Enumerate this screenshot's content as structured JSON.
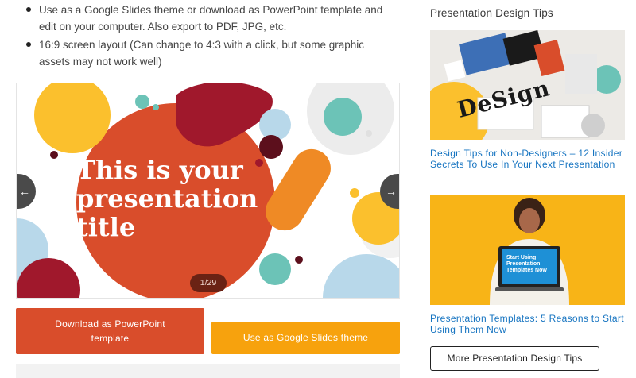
{
  "features": {
    "bullets": [
      "Use as a Google Slides theme or download as PowerPoint template and edit on your computer. Also export to PDF, JPG, etc.",
      "16:9 screen layout (Can change to 4:3 with a click, but some graphic assets may not work well)"
    ]
  },
  "slider": {
    "slide_title": "This is your\npresentation\ntitle",
    "counter": "1/29",
    "prev_icon": "arrow-left",
    "next_icon": "arrow-right"
  },
  "actions": {
    "download_ppt": "Download as PowerPoint template",
    "use_google_slides": "Use as Google Slides theme"
  },
  "sidebar": {
    "heading": "Presentation Design Tips",
    "posts": [
      {
        "thumb_text": "DeSign",
        "title": "Design Tips for Non-Designers – 12 Insider Secrets To Use In Your Next Presentation"
      },
      {
        "thumb_text": "Start Using\nPresentation\nTemplates Now",
        "title": "Presentation Templates: 5 Reasons to Start Using Them Now"
      }
    ],
    "more_button": "More Presentation Design Tips"
  },
  "colors": {
    "ppt_button": "#d94d2b",
    "gslides_button": "#f7a20d",
    "link": "#1674c1",
    "slide_red": "#d94d2b",
    "slide_yellow": "#fbc02d",
    "slide_teal": "#6cc3b7",
    "slide_maroon": "#a0182c"
  }
}
